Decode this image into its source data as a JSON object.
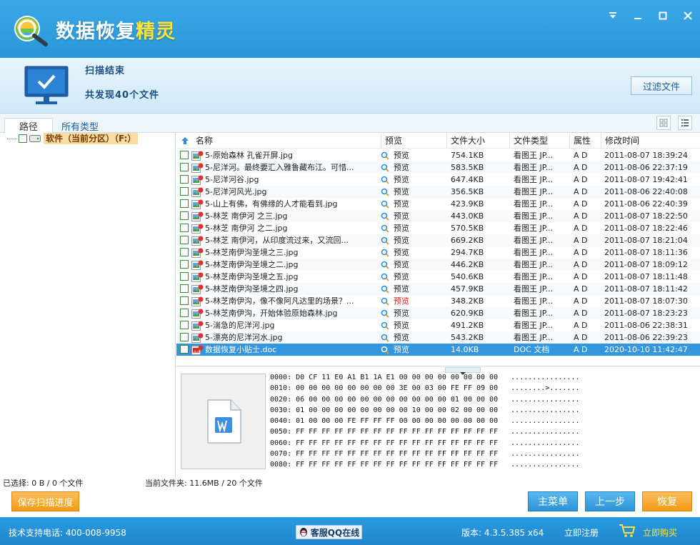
{
  "app": {
    "title_main": "数据恢复",
    "title_hl": "精灵"
  },
  "status": {
    "scan_status": "扫描结束",
    "found_count": "共发现40个文件",
    "filter_button": "过滤文件"
  },
  "tabs": {
    "path": "路径",
    "all_types": "所有类型"
  },
  "tree": {
    "partition_label": "软件（当前分区）（F:）"
  },
  "columns": {
    "name": "名称",
    "preview": "预览",
    "size": "文件大小",
    "type": "文件类型",
    "attr": "属性",
    "mtime": "修改时间"
  },
  "files": [
    {
      "name": "5-原始森林 孔雀开屏.jpg",
      "preview": "预览",
      "size": "754.1KB",
      "type": "看图王 JP...",
      "attr": "A D",
      "mtime": "2011-08-07 18:39:24"
    },
    {
      "name": "5-尼洋河。最终要汇入雅鲁藏布江。可惜...",
      "preview": "预览",
      "size": "583.5KB",
      "type": "看图王 JP...",
      "attr": "A D",
      "mtime": "2011-08-06 22:37:19"
    },
    {
      "name": "5-尼洋河谷.jpg",
      "preview": "预览",
      "size": "647.4KB",
      "type": "看图王 JP...",
      "attr": "A D",
      "mtime": "2011-08-07 19:42:41"
    },
    {
      "name": "5-尼洋河风光.jpg",
      "preview": "预览",
      "size": "356.5KB",
      "type": "看图王 JP...",
      "attr": "A D",
      "mtime": "2011-08-06 22:40:08"
    },
    {
      "name": "5-山上有佛，有佛缘的人才能看到.jpg",
      "preview": "预览",
      "size": "423.9KB",
      "type": "看图王 JP...",
      "attr": "A D",
      "mtime": "2011-08-06 22:40:39"
    },
    {
      "name": "5-林芝 南伊河 之三.jpg",
      "preview": "预览",
      "size": "443.0KB",
      "type": "看图王 JP...",
      "attr": "A D",
      "mtime": "2011-08-07 18:22:50"
    },
    {
      "name": "5-林芝 南伊河 之二.jpg",
      "preview": "预览",
      "size": "570.5KB",
      "type": "看图王 JP...",
      "attr": "A D",
      "mtime": "2011-08-07 18:22:46"
    },
    {
      "name": "5-林芝 南伊河，从印度流过来，又流回...",
      "preview": "预览",
      "size": "669.2KB",
      "type": "看图王 JP...",
      "attr": "A D",
      "mtime": "2011-08-07 18:21:04"
    },
    {
      "name": "5-林芝南伊沟圣境之三.jpg",
      "preview": "预览",
      "size": "294.7KB",
      "type": "看图王 JP...",
      "attr": "A D",
      "mtime": "2011-08-07 18:11:36"
    },
    {
      "name": "5-林芝南伊沟圣境之二.jpg",
      "preview": "预览",
      "size": "446.2KB",
      "type": "看图王 JP...",
      "attr": "A D",
      "mtime": "2011-08-07 18:09:12"
    },
    {
      "name": "5-林芝南伊沟圣境之五.jpg",
      "preview": "预览",
      "size": "540.6KB",
      "type": "看图王 JP...",
      "attr": "A D",
      "mtime": "2011-08-07 18:11:48"
    },
    {
      "name": "5-林芝南伊沟圣境之四.jpg",
      "preview": "预览",
      "size": "457.9KB",
      "type": "看图王 JP...",
      "attr": "A D",
      "mtime": "2011-08-07 18:11:42"
    },
    {
      "name": "5-林芝南伊沟，像不像阿凡达里的场景？...",
      "preview": "预览",
      "size": "348.2KB",
      "type": "看图王 JP...",
      "attr": "A D",
      "mtime": "2011-08-07 18:07:30"
    },
    {
      "name": "5-林芝南伊沟，开始体验原始森林.jpg",
      "preview": "预览",
      "size": "620.9KB",
      "type": "看图王 JP...",
      "attr": "A D",
      "mtime": "2011-08-07 18:23:23"
    },
    {
      "name": "5-湍急的尼洋河.jpg",
      "preview": "预览",
      "size": "491.2KB",
      "type": "看图王 JP...",
      "attr": "A D",
      "mtime": "2011-08-06 22:38:31"
    },
    {
      "name": "5-漂亮的尼洋河水.jpg",
      "preview": "预览",
      "size": "543.2KB",
      "type": "看图王 JP...",
      "attr": "A D",
      "mtime": "2011-08-06 22:39:23"
    },
    {
      "name": "数据恢复小贴士.doc",
      "preview": "预览",
      "size": "14.0KB",
      "type": "DOC 文档",
      "attr": "A D",
      "mtime": "2020-10-10 11:42:47"
    }
  ],
  "hex_lines": [
    "0000: D0 CF 11 E0 A1 B1 1A E1 00 00 00 00 00 00 00 00   ................",
    "0010: 00 00 00 00 00 00 00 00 3E 00 03 00 FE FF 09 00   ........>.......",
    "0020: 06 00 00 00 00 00 00 00 00 00 00 00 01 00 00 00   ................",
    "0030: 01 00 00 00 00 00 00 00 00 10 00 00 02 00 00 00   ................",
    "0040: 01 00 00 00 FE FF FF FF 00 00 00 00 00 00 00 00   ................",
    "0050: FF FF FF FF FF FF FF FF FF FF FF FF FF FF FF FF   ................",
    "0060: FF FF FF FF FF FF FF FF FF FF FF FF FF FF FF FF   ................",
    "0070: FF FF FF FF FF FF FF FF FF FF FF FF FF FF FF FF   ................",
    "0080: FF FF FF FF FF FF FF FF FF FF FF FF FF FF FF FF   ................"
  ],
  "info": {
    "selected": "已选择: 0 B / 0 个文件",
    "current_folder": "当前文件夹: 11.6MB / 20 个文件"
  },
  "buttons": {
    "save_progress": "保存扫描进度",
    "main_menu": "主菜单",
    "prev_step": "上一步",
    "recover": "恢复"
  },
  "footer": {
    "support": "技术支持电话: 400-008-9958",
    "qq": "客服QQ在线",
    "version": "版本: 4.3.5.385 x64",
    "register": "立即注册",
    "buy": "立即购买"
  },
  "colors": {
    "title_blue": "#2996d8",
    "accent_orange": "#f39b16",
    "selection_blue": "#3296e0",
    "highlight_yellow": "#ffe23a"
  }
}
